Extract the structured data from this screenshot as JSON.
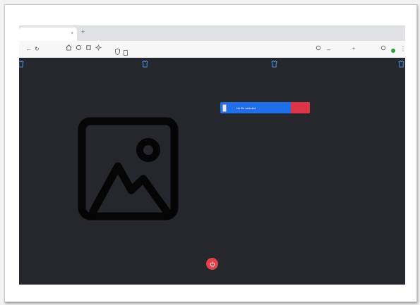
{
  "browser": {
    "tab_title": "",
    "tab_close": "×",
    "new_tab": "+",
    "url_host": "",
    "url_path": "",
    "zoom": ""
  },
  "nav": {
    "items": [
      {
        "label": "",
        "icon": "shirt-icon"
      },
      {
        "label": "",
        "icon": "shirt-icon"
      },
      {
        "label": "",
        "icon": "shirt-icon"
      },
      {
        "label": "",
        "icon": "shirt-icon"
      }
    ]
  },
  "upload": {
    "label": "",
    "browse_label": "",
    "file_status": "No file selected",
    "submit_label": ""
  },
  "colors": {
    "page_bg": "#25272c",
    "accent": "#1f6feb",
    "danger": "#dc3545",
    "nav_icon": "#4ea1ff",
    "fab": "#e0414a"
  },
  "icons": {
    "image_placeholder": "image-icon",
    "fab": "power-icon"
  }
}
